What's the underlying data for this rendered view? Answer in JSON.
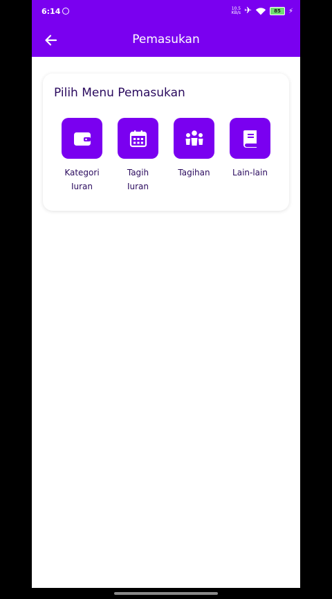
{
  "status": {
    "time": "6:14",
    "net_speed_value": "10.5",
    "net_speed_unit": "KB/s",
    "battery": "85"
  },
  "appbar": {
    "title": "Pemasukan"
  },
  "card": {
    "title": "Pilih Menu Pemasukan",
    "items": [
      {
        "line1": "Kategori",
        "line2": "Iuran",
        "icon": "wallet-icon"
      },
      {
        "line1": "Tagih",
        "line2": "Iuran",
        "icon": "calendar-icon"
      },
      {
        "line1": "Tagihan",
        "line2": "",
        "icon": "group-icon"
      },
      {
        "line1": "Lain-lain",
        "line2": "",
        "icon": "book-icon"
      }
    ]
  },
  "colors": {
    "primary": "#7a00f0",
    "text_dark": "#2a0a5e"
  }
}
